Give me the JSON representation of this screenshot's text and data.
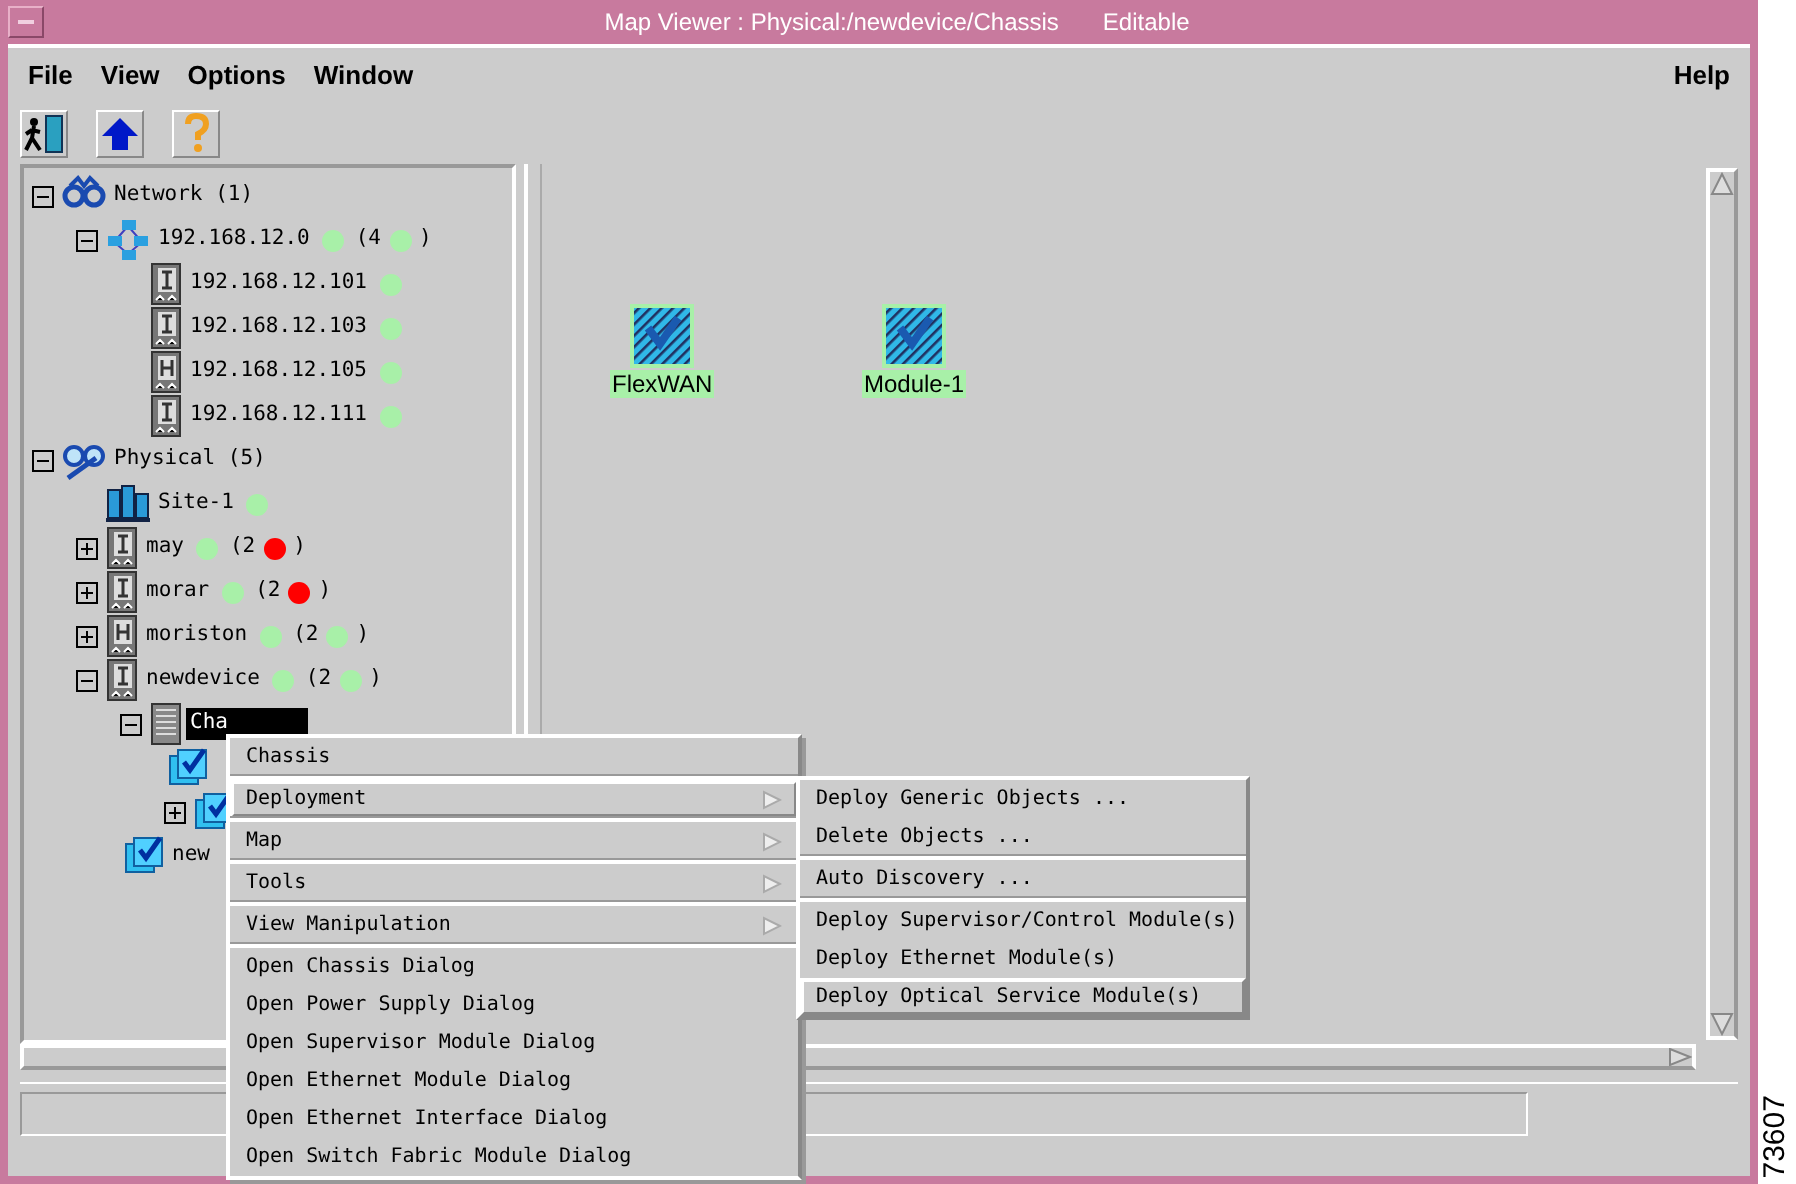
{
  "window": {
    "title": "Map Viewer : Physical:/newdevice/Chassis",
    "mode": "Editable"
  },
  "menubar": {
    "left": [
      {
        "label": "File"
      },
      {
        "label": "View"
      },
      {
        "label": "Options"
      },
      {
        "label": "Window"
      }
    ],
    "right": [
      {
        "label": "Help"
      }
    ]
  },
  "toolbar": [
    {
      "kind": "exit"
    },
    {
      "kind": "up"
    },
    {
      "kind": "help"
    }
  ],
  "tree": [
    {
      "label": "Network (1)",
      "kind": "network",
      "expanded": true,
      "selected": false,
      "children": [
        {
          "label": "192.168.12.0",
          "kind": "subnet",
          "expanded": true,
          "selected": false,
          "color": "#a8f0a8",
          "count": {
            "prefix": "(4",
            "color": "#a8f0a8",
            "suffix": ")"
          },
          "children": [
            {
              "label": "192.168.12.101",
              "kind": "device",
              "selected": false,
              "color": "#a8f0a8"
            },
            {
              "label": "192.168.12.103",
              "kind": "device",
              "selected": false,
              "color": "#a8f0a8"
            },
            {
              "label": "192.168.12.105",
              "kind": "device_h",
              "selected": false,
              "color": "#a8f0a8"
            },
            {
              "label": "192.168.12.111",
              "kind": "device",
              "selected": false,
              "color": "#a8f0a8"
            }
          ]
        }
      ]
    },
    {
      "label": "Physical (5)",
      "kind": "physical",
      "expanded": true,
      "selected": false,
      "children": [
        {
          "label": "Site-1",
          "kind": "site",
          "selected": false,
          "color": "#a8f0a8"
        },
        {
          "label": "may",
          "kind": "device",
          "expanded": false,
          "selected": false,
          "color": "#a8f0a8",
          "count": {
            "prefix": "(2",
            "color": "#ff0000",
            "suffix": ")"
          }
        },
        {
          "label": "morar",
          "kind": "device",
          "expanded": false,
          "selected": false,
          "color": "#a8f0a8",
          "count": {
            "prefix": "(2",
            "color": "#ff0000",
            "suffix": ")"
          }
        },
        {
          "label": "moriston",
          "kind": "device_h",
          "expanded": false,
          "selected": false,
          "color": "#a8f0a8",
          "count": {
            "prefix": "(2",
            "color": "#a8f0a8",
            "suffix": ")"
          }
        },
        {
          "label": "newdevice",
          "kind": "device",
          "expanded": true,
          "selected": false,
          "color": "#a8f0a8",
          "count": {
            "prefix": "(2",
            "color": "#a8f0a8",
            "suffix": ")"
          },
          "children": [
            {
              "label": "Cha",
              "kind": "chassis",
              "expanded": true,
              "selected": true,
              "children": [
                {
                  "kind": "module"
                },
                {
                  "kind": "module",
                  "expanded": false
                }
              ]
            },
            {
              "label": "new",
              "kind": "module",
              "selected": false
            }
          ]
        }
      ]
    }
  ],
  "map_nodes": [
    {
      "label": "FlexWAN"
    },
    {
      "label": "Module-1"
    }
  ],
  "context_menu": {
    "groups": [
      [
        {
          "label": "Chassis",
          "has_submenu": false,
          "selected": false
        }
      ],
      [
        {
          "label": "Deployment",
          "has_submenu": true,
          "selected": true
        }
      ],
      [
        {
          "label": "Map",
          "has_submenu": true,
          "selected": false
        }
      ],
      [
        {
          "label": "Tools",
          "has_submenu": true,
          "selected": false
        }
      ],
      [
        {
          "label": "View Manipulation",
          "has_submenu": true,
          "selected": false
        }
      ],
      [
        {
          "label": "Open Chassis Dialog",
          "has_submenu": false,
          "selected": false
        },
        {
          "label": "Open Power Supply Dialog",
          "has_submenu": false,
          "selected": false
        },
        {
          "label": "Open Supervisor Module Dialog",
          "has_submenu": false,
          "selected": false
        },
        {
          "label": "Open Ethernet Module Dialog",
          "has_submenu": false,
          "selected": false
        },
        {
          "label": "Open Ethernet Interface Dialog",
          "has_submenu": false,
          "selected": false
        },
        {
          "label": "Open Switch Fabric Module Dialog",
          "has_submenu": false,
          "selected": false
        }
      ]
    ]
  },
  "submenu": {
    "groups": [
      [
        {
          "label": "Deploy Generic Objects ...",
          "selected": false
        },
        {
          "label": "Delete Objects ...",
          "selected": false
        }
      ],
      [
        {
          "label": "Auto Discovery ...",
          "selected": false
        }
      ],
      [
        {
          "label": "Deploy Supervisor/Control Module(s)",
          "selected": false
        },
        {
          "label": "Deploy Ethernet Module(s)",
          "selected": false
        },
        {
          "label": "Deploy Optical Service Module(s)",
          "selected": true
        }
      ]
    ]
  },
  "figure_number": "73607"
}
